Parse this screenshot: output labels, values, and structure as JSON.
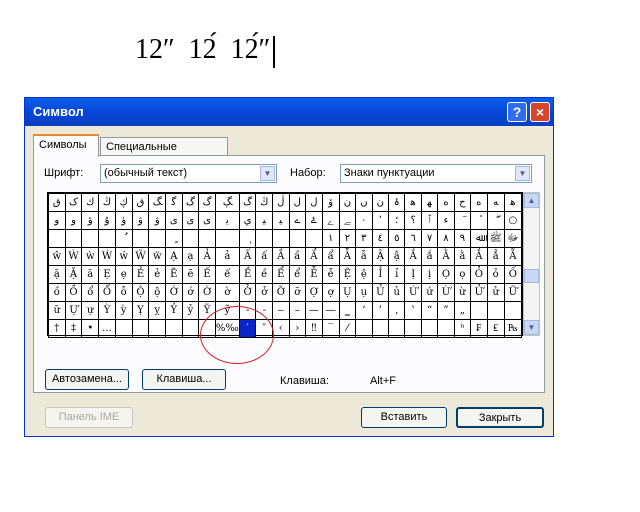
{
  "document": {
    "text": "12″  12́  12́″"
  },
  "dialog": {
    "title": "Символ",
    "help_glyph": "?",
    "close_glyph": "×",
    "tabs": [
      {
        "label": "Символы",
        "active": true
      },
      {
        "label": "Специальные символы",
        "active": false
      }
    ],
    "font_label": "Шрифт:",
    "font_value": "(обычный текст)",
    "subset_label": "Набор:",
    "subset_value": "Знаки пунктуации",
    "grid_rows": [
      [
        "ق",
        "ک",
        "ﻙ",
        "ڭ",
        "ڮ",
        "ﻕ",
        "ﮓ",
        "ﮔ",
        "گ",
        "ﮒ",
        "ﮗ",
        "گ",
        "ﯓ",
        "ڷ",
        "ﻝ",
        "ل",
        "ۆ",
        "ﻥ",
        "ں",
        "ن",
        "ۂ",
        "ﻫ",
        "ﻬ",
        "ه",
        "ح",
        "ﻩ",
        "ﻪ",
        "ﻫ",
        "ﻉ"
      ],
      [
        "و",
        "ﻭ",
        "ؤ",
        "ۇ",
        "ۈ",
        "ۋ",
        "ﯞ",
        "ﻯ",
        "ﯼ",
        "ى",
        "ﯾ",
        "ي",
        "ﯿ",
        "ﻴ",
        "ے",
        "ۓ",
        "ﮮ",
        "ﮯ",
        "٠",
        "٬",
        "؛",
        "؟",
        "ﭐ",
        "ﺀ",
        "ٓ",
        "ٔ",
        "ۖ",
        "○",
        "◎",
        "ٔ"
      ],
      [
        "",
        "",
        "",
        "",
        "ٌ",
        "",
        "",
        "ٍ",
        "",
        "",
        "",
        "ٖ",
        "",
        "",
        "",
        "",
        "١",
        "٢",
        "٣",
        "٤",
        "٥",
        "٦",
        "٧",
        "٨",
        "٩",
        "ﷲ",
        "ﷺ",
        "ﷻ",
        "ﷹ"
      ],
      [
        "ŵ",
        "Ẁ",
        "ẁ",
        "Ẃ",
        "ẃ",
        "Ẅ",
        "ẅ",
        "Ạ",
        "ạ",
        "Ả",
        "ả",
        "Ấ",
        "ấ",
        "Ầ",
        "ầ",
        "Ẩ",
        "ẩ",
        "Ẫ",
        "ẫ",
        "Ậ",
        "ậ",
        "Ắ",
        "ắ",
        "Ằ",
        "ằ",
        "Ẳ",
        "ẳ",
        "Ẵ",
        "ẵ"
      ],
      [
        "ặ",
        "Ặ",
        "ă",
        "Ẹ",
        "ẹ",
        "Ẻ",
        "ẻ",
        "Ẽ",
        "ẽ",
        "Ế",
        "ế",
        "Ề",
        "ề",
        "Ể",
        "ể",
        "Ễ",
        "ễ",
        "Ệ",
        "ệ",
        "Ỉ",
        "ỉ",
        "Ị",
        "ị",
        "Ọ",
        "ọ",
        "Ỏ",
        "ỏ",
        "Ố",
        "ố"
      ],
      [
        "ồ",
        "Ồ",
        "ổ",
        "Ổ",
        "ỗ",
        "Ộ",
        "ộ",
        "Ớ",
        "ớ",
        "Ờ",
        "ờ",
        "Ở",
        "ở",
        "Ỡ",
        "ỡ",
        "Ợ",
        "ợ",
        "Ụ",
        "ụ",
        "Ủ",
        "ủ",
        "Ứ",
        "ứ",
        "Ừ",
        "ừ",
        "Ử",
        "ử",
        "Ữ",
        "Ữ"
      ],
      [
        "ữ",
        "Ự",
        "ự",
        "Ỳ",
        "ỳ",
        "Ỵ",
        "ỵ",
        "Ỷ",
        "ỷ",
        "Ỹ",
        "ỹ",
        "‐",
        "‑",
        "‒",
        "–",
        "—",
        "―",
        "‗",
        "‘",
        "’",
        "‚",
        "‛",
        "“",
        "”",
        "„",
        ""
      ],
      [
        "†",
        "‡",
        "•",
        "…",
        "",
        "",
        "",
        "",
        "",
        "",
        "%‰",
        "′",
        "″",
        "‹",
        "›",
        "‼",
        "‾",
        "⁄",
        "",
        "",
        "",
        "",
        "",
        "",
        "ⁿ",
        "₣",
        "₤",
        "₧",
        "₪"
      ]
    ],
    "selected_cell": [
      7,
      11
    ],
    "autocorrect_button": "Автозамена...",
    "shortcut_key_button": "Клавиша...",
    "shortcut_label": "Клавиша:",
    "shortcut_value": "Alt+F",
    "ime_button": "Панель IME",
    "insert_button": "Вставить",
    "close_button": "Закрыть",
    "scroll_up_glyph": "▲",
    "scroll_down_glyph": "▼",
    "combo_arrow_glyph": "▼"
  },
  "colors": {
    "titlebar": "#0a5fe8",
    "selection": "#0a24c8",
    "annotation": "#d02020"
  }
}
